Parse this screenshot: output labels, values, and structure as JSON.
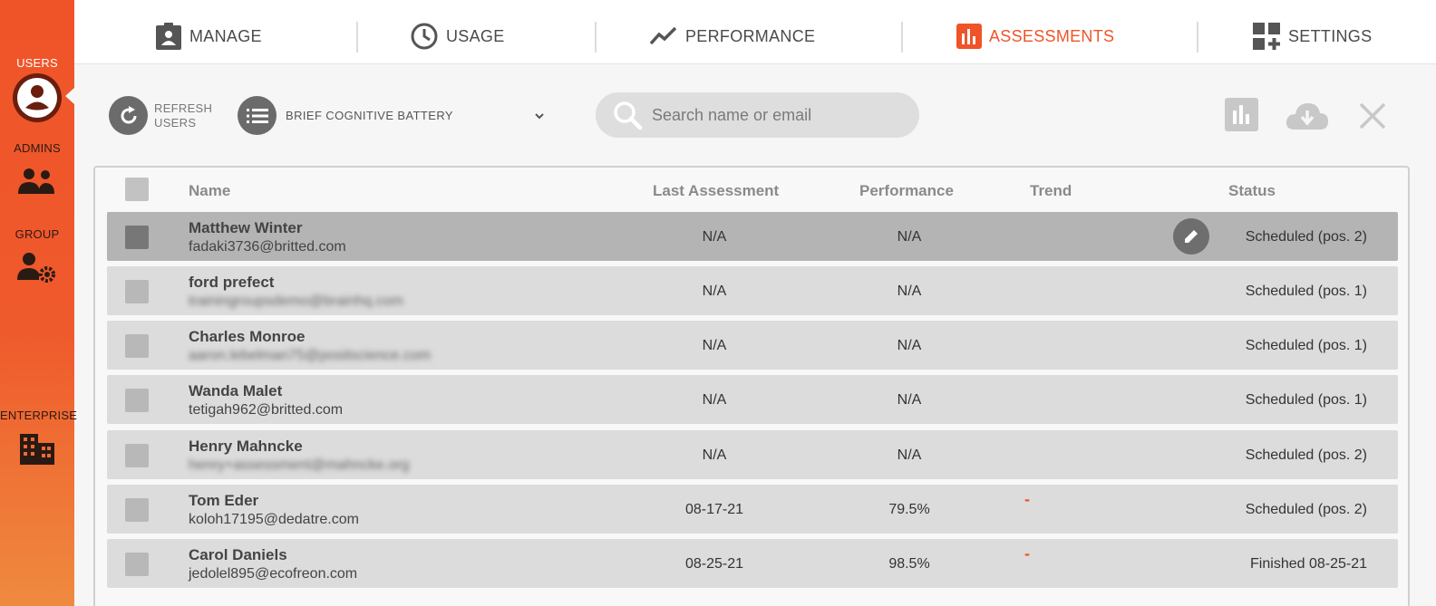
{
  "sidebar": {
    "items": [
      {
        "label": "USERS",
        "icon": "user-circle-icon",
        "active": true
      },
      {
        "label": "ADMINS",
        "icon": "people-icon"
      },
      {
        "label": "GROUP",
        "icon": "group-settings-icon"
      },
      {
        "label": "ENTERPRISE",
        "icon": "building-icon"
      }
    ],
    "accent": "#ef5428"
  },
  "nav": {
    "tabs": [
      {
        "label": "MANAGE",
        "icon": "clipboard-badge-icon"
      },
      {
        "label": "USAGE",
        "icon": "clock-icon"
      },
      {
        "label": "PERFORMANCE",
        "icon": "trend-line-icon"
      },
      {
        "label": "ASSESSMENTS",
        "icon": "bar-chart-icon",
        "active": true
      },
      {
        "label": "SETTINGS",
        "icon": "grid-plus-icon"
      }
    ]
  },
  "toolbar": {
    "refresh_label": "REFRESH USERS",
    "battery_label": "BRIEF COGNITIVE BATTERY",
    "search_placeholder": "Search name or email"
  },
  "table": {
    "headers": {
      "name": "Name",
      "last": "Last Assessment",
      "performance": "Performance",
      "trend": "Trend",
      "status": "Status"
    },
    "rows": [
      {
        "name": "Matthew Winter",
        "email": "fadaki3736@britted.com",
        "last": "N/A",
        "performance": "N/A",
        "trend": "",
        "status": "Scheduled (pos. 2)",
        "selected": true,
        "email_blurred": false
      },
      {
        "name": "ford prefect",
        "email": "trainingroupsdemo@brainhq.com",
        "last": "N/A",
        "performance": "N/A",
        "trend": "",
        "status": "Scheduled (pos. 1)",
        "email_blurred": true
      },
      {
        "name": "Charles Monroe",
        "email": "aaron.lebelman75@positscience.com",
        "last": "N/A",
        "performance": "N/A",
        "trend": "",
        "status": "Scheduled (pos. 1)",
        "email_blurred": true
      },
      {
        "name": "Wanda Malet",
        "email": "tetigah962@britted.com",
        "last": "N/A",
        "performance": "N/A",
        "trend": "",
        "status": "Scheduled (pos. 1)",
        "email_blurred": false
      },
      {
        "name": "Henry Mahncke",
        "email": "henry+assessment@mahncke.org",
        "last": "N/A",
        "performance": "N/A",
        "trend": "",
        "status": "Scheduled (pos. 2)",
        "email_blurred": true
      },
      {
        "name": "Tom Eder",
        "email": "koloh17195@dedatre.com",
        "last": "08-17-21",
        "performance": "79.5%",
        "trend": "-",
        "status": "Scheduled (pos. 2)",
        "email_blurred": false
      },
      {
        "name": "Carol Daniels",
        "email": "jedolel895@ecofreon.com",
        "last": "08-25-21",
        "performance": "98.5%",
        "trend": "-",
        "status": "Finished 08-25-21",
        "email_blurred": false
      }
    ]
  }
}
